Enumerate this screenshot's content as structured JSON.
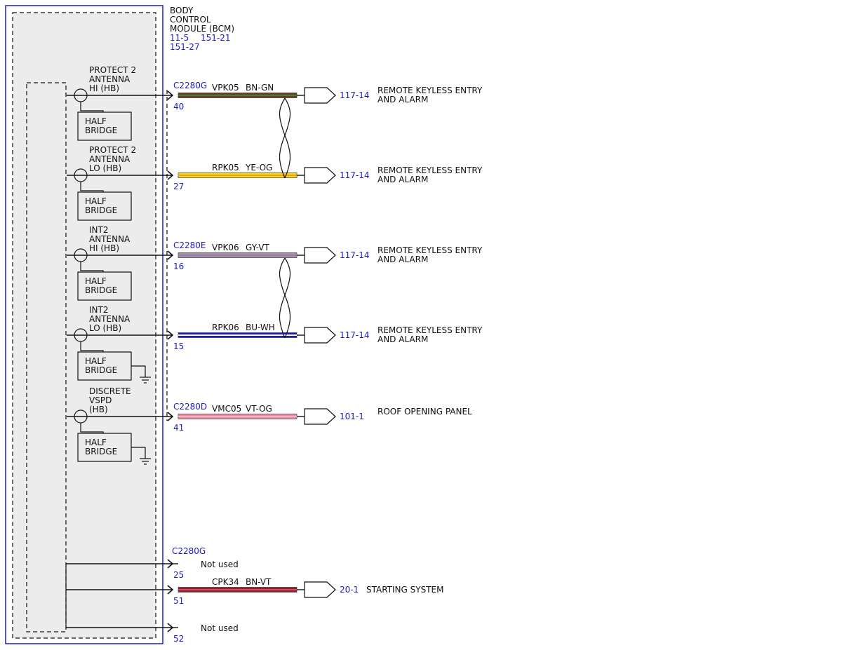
{
  "module": {
    "title_lines": [
      "BODY",
      "CONTROL",
      "MODULE (BCM)"
    ],
    "refs_line1": [
      "11-5",
      "151-21"
    ],
    "refs_line2": "151-27"
  },
  "half_bridge_lines": [
    "HALF",
    "BRIDGE"
  ],
  "circuits": [
    {
      "function_lines": [
        "PROTECT 2",
        "ANTENNA",
        "HI (HB)"
      ],
      "connector": "C2280G",
      "pin": "40",
      "circuit": "VPK05",
      "wire_color": "BN-GN",
      "wire_main": "#7a3520",
      "wire_stripe": "#2f8a3a",
      "dest_ref": "117-14",
      "dest_lines": [
        "REMOTE KEYLESS ENTRY",
        "AND ALARM"
      ],
      "ground": false
    },
    {
      "function_lines": [
        "PROTECT 2",
        "ANTENNA",
        "LO (HB)"
      ],
      "connector": "",
      "pin": "27",
      "circuit": "RPK05",
      "wire_color": "YE-OG",
      "wire_main": "#f2dc16",
      "wire_stripe": "#f29a1c",
      "dest_ref": "117-14",
      "dest_lines": [
        "REMOTE KEYLESS ENTRY",
        "AND ALARM"
      ],
      "ground": false
    },
    {
      "function_lines": [
        "INT2",
        "ANTENNA",
        "HI (HB)"
      ],
      "connector": "C2280E",
      "pin": "16",
      "circuit": "VPK06",
      "wire_color": "GY-VT",
      "wire_main": "#9a9a9a",
      "wire_stripe": "#b06cc0",
      "dest_ref": "117-14",
      "dest_lines": [
        "REMOTE KEYLESS ENTRY",
        "AND ALARM"
      ],
      "ground": false
    },
    {
      "function_lines": [
        "INT2",
        "ANTENNA",
        "LO (HB)"
      ],
      "connector": "",
      "pin": "15",
      "circuit": "RPK06",
      "wire_color": "BU-WH",
      "wire_main": "#1a1ad4",
      "wire_stripe": "#ffffff",
      "dest_ref": "117-14",
      "dest_lines": [
        "REMOTE KEYLESS ENTRY",
        "AND ALARM"
      ],
      "ground": true
    },
    {
      "function_lines": [
        "DISCRETE",
        "VSPD",
        "(HB)"
      ],
      "connector": "C2280D",
      "pin": "41",
      "circuit": "VMC05",
      "wire_color": "VT-OG",
      "wire_main": "#f08aa0",
      "wire_stripe": "#f6b7c4",
      "dest_ref": "101-1",
      "dest_lines": [
        "ROOF OPENING PANEL"
      ],
      "ground": true
    }
  ],
  "bottom_connector": "C2280G",
  "bottom_pins": [
    {
      "pin": "25",
      "not_used": "Not used"
    },
    {
      "pin": "51",
      "circuit": "CPK34",
      "wire_color": "BN-VT",
      "wire_main": "#8a2230",
      "wire_stripe": "#d0505a",
      "dest_ref": "20-1",
      "dest_lines": [
        "STARTING SYSTEM"
      ]
    },
    {
      "pin": "52",
      "not_used": "Not used"
    }
  ],
  "colors": {
    "frame": "#1a1ad4",
    "module_fill": "#ececec",
    "ref_text": "#1a1ad4",
    "line": "#111111"
  }
}
